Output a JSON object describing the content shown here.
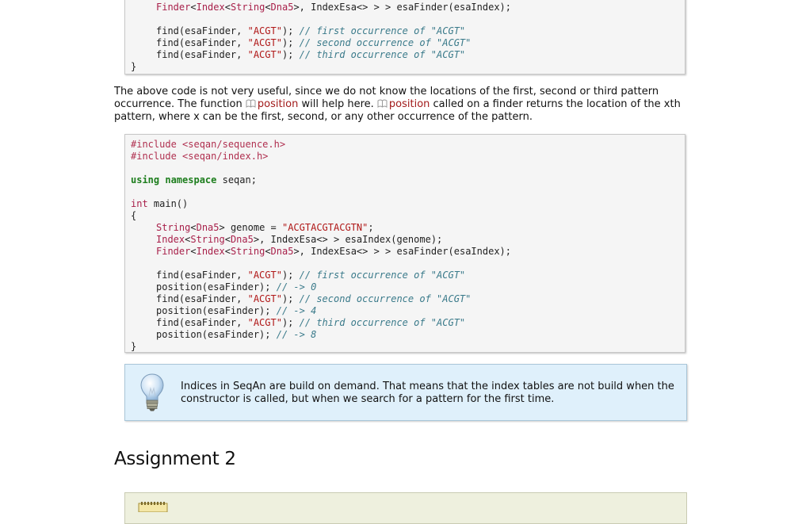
{
  "code_block_1": {
    "lines": [
      "Finder<Index<String<Dna5>, IndexEsa<> > > esaFinder(esaIndex);",
      "",
      "find(esaFinder, \"ACGT\"); // first occurrence of \"ACGT\"",
      "find(esaFinder, \"ACGT\"); // second occurrence of \"ACGT\"",
      "find(esaFinder, \"ACGT\"); // third occurrence of \"ACGT\"",
      "}"
    ]
  },
  "paragraph": {
    "text_1": "The above code is not very useful, since we do not know the locations of the first, second or third pattern occurrence. The function ",
    "link_1": "position",
    "text_2": " will help here. ",
    "link_2": "position",
    "text_3": " called on a finder returns the location of the xth pattern, where x can be the first, second, or any other occurrence of the pattern."
  },
  "code_block_2": {
    "include_1": "#include <seqan/sequence.h>",
    "include_2": "#include <seqan/index.h>",
    "using_kw": "using namespace",
    "using_rest": " seqan;",
    "main_type": "int",
    "main_rest": " main()",
    "open_brace": "{",
    "close_brace": "}",
    "genome_decl": "String<Dna5> genome = ",
    "genome_str": "\"ACGTACGTACGTN\"",
    "semicolon": ";",
    "index_decl": "Index<String<Dna5>, IndexEsa<> > esaIndex(genome);",
    "finder_decl": "Finder<Index<String<Dna5>, IndexEsa<> > > esaFinder(esaIndex);",
    "find_prefix": "find(esaFinder, ",
    "acgt": "\"ACGT\"",
    "find_suffix": "); ",
    "comment_first": "// first occurrence of \"ACGT\"",
    "comment_second": "// second occurrence of \"ACGT\"",
    "comment_third": "// third occurrence of \"ACGT\"",
    "position_call": "position(esaFinder); ",
    "result_0": "// -> 0",
    "result_4": "// -> 4",
    "result_8": "// -> 8"
  },
  "note": {
    "text": "Indices in SeqAn are build on demand. That means that the index tables are not build when the constructor is called, but when we search for a pattern for the first time.",
    "icon": "lightbulb-icon"
  },
  "assignment": {
    "heading": "Assignment 2",
    "icon": "notepad-icon"
  },
  "colors": {
    "keyword": "#1e7e1e",
    "string": "#b01818",
    "comment": "#3a7a8a",
    "link": "#a11a1a",
    "note_bg": "#dff0fb",
    "assignment_bg": "#eef0de"
  }
}
